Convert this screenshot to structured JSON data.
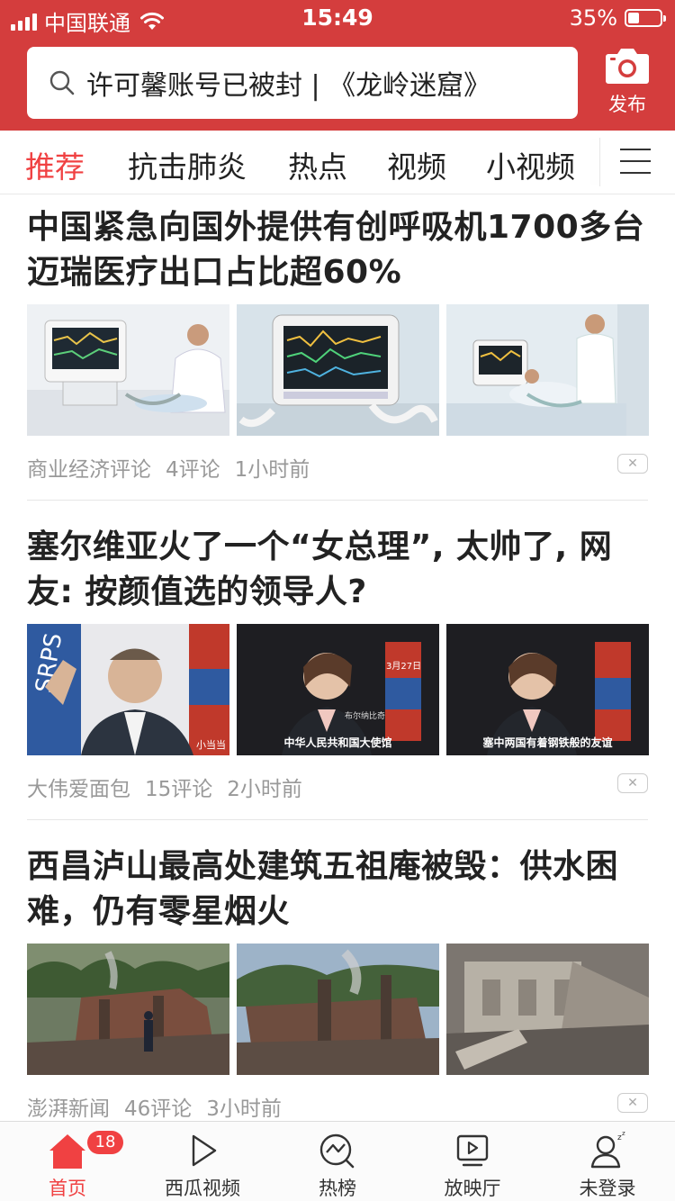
{
  "status_bar": {
    "carrier": "中国联通",
    "time": "15:49",
    "battery_percent": "35%",
    "battery_level": 0.35
  },
  "search": {
    "text": "许可馨账号已被封 | 《龙岭迷窟》",
    "icon": "search-icon"
  },
  "publish": {
    "label": "发布",
    "icon": "camera-icon"
  },
  "tabs": [
    {
      "label": "推荐",
      "active": true
    },
    {
      "label": "抗击肺炎"
    },
    {
      "label": "热点"
    },
    {
      "label": "视频"
    },
    {
      "label": "小视频"
    }
  ],
  "articles": [
    {
      "title": "中国紧急向国外提供有创呼吸机1700多台 迈瑞医疗出口占比超60%",
      "source": "商业经济评论",
      "comments": "4评论",
      "time": "1小时前",
      "thumbs": [
        {
          "watermark": ""
        },
        {
          "watermark": ""
        },
        {
          "watermark": ""
        }
      ]
    },
    {
      "title": "塞尔维亚火了一个“女总理”, 太帅了, 网友: 按颜值选的领导人?",
      "source": "大伟爱面包",
      "comments": "15评论",
      "time": "2小时前",
      "thumbs": [
        {
          "watermark": "小当当"
        },
        {
          "caption": "中华人民共和国大使馆",
          "tag_date": "3月27日",
          "name_tag": "布尔纳比奇"
        },
        {
          "caption": "塞中两国有着钢铁般的友谊"
        }
      ]
    },
    {
      "title": "西昌泸山最高处建筑五祖庵被毁：供水困难，仍有零星烟火",
      "source": "澎湃新闻",
      "comments": "46评论",
      "time": "3小时前",
      "thumbs": [
        {
          "watermark": ""
        },
        {
          "watermark": ""
        },
        {
          "watermark": ""
        }
      ]
    }
  ],
  "bottom_nav": [
    {
      "label": "首页",
      "icon": "home-icon",
      "badge": "18",
      "active": true
    },
    {
      "label": "西瓜视频",
      "icon": "play-icon"
    },
    {
      "label": "热榜",
      "icon": "trending-icon"
    },
    {
      "label": "放映厅",
      "icon": "screening-icon"
    },
    {
      "label": "未登录",
      "icon": "user-icon"
    }
  ],
  "colors": {
    "header_red": "#d43d3d",
    "accent_red": "#f04142",
    "meta_gray": "#999999"
  }
}
